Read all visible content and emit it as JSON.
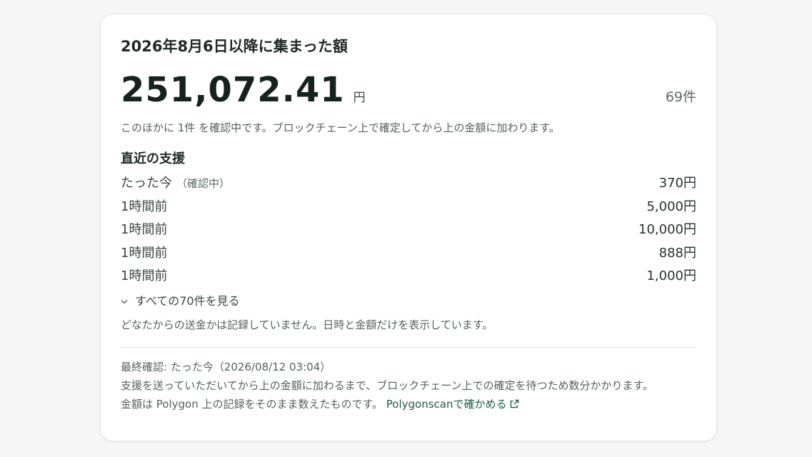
{
  "card": {
    "title": "2026年8月6日以降に集まった額",
    "total_amount": "251,072.41",
    "total_unit": "円",
    "total_count": "69件",
    "pending_note": "このほかに 1件 を確認中です。ブロックチェーン上で確定してから上の金額に加わります。"
  },
  "recent": {
    "title": "直近の支援",
    "items": [
      {
        "time": "たった今",
        "tag": "（確認中）",
        "amount": "370円"
      },
      {
        "time": "1時間前",
        "tag": "",
        "amount": "5,000円"
      },
      {
        "time": "1時間前",
        "tag": "",
        "amount": "10,000円"
      },
      {
        "time": "1時間前",
        "tag": "",
        "amount": "888円"
      },
      {
        "time": "1時間前",
        "tag": "",
        "amount": "1,000円"
      }
    ],
    "see_all_label": "すべての70件を見る",
    "anon_note": "どなたからの送金かは記録していません。日時と金額だけを表示しています。"
  },
  "footer": {
    "last_checked": "最終確認: たった今（2026/08/12 03:04）",
    "delay_note": "支援を送っていただいてから上の金額に加わるまで、ブロックチェーン上での確定を待つため数分かかります。",
    "source_note": "金額は Polygon 上の記録をそのまま数えたものです。",
    "link_label": "Polygonscanで確かめる",
    "link_icon": "external-link-icon"
  },
  "colors": {
    "accent_link": "#1e5b44",
    "text_primary": "#1f2a25",
    "text_muted": "#55625c"
  }
}
